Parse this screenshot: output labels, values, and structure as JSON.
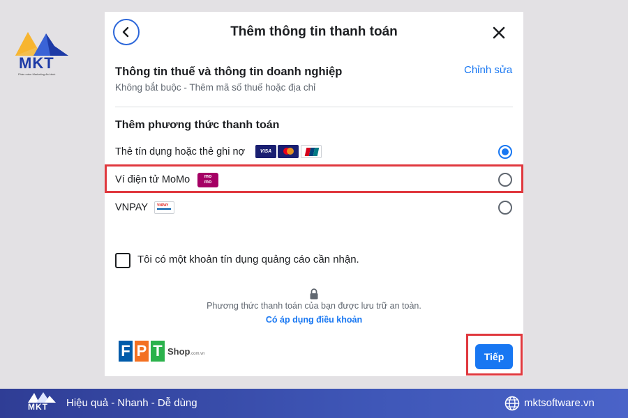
{
  "brand": {
    "logo_text": "MKT",
    "logo_tagline": "Phần mềm Marketing đa kênh",
    "colors": {
      "blue": "#1d3aa6",
      "orange": "#f5a623",
      "accent": "#1877f2",
      "highlight": "#e0383e"
    }
  },
  "dialog": {
    "title": "Thêm thông tin thanh toán",
    "back_icon": "chevron-left-icon",
    "close_icon": "close-icon",
    "tax": {
      "title": "Thông tin thuế và thông tin doanh nghiệp",
      "subtitle": "Không bắt buộc - Thêm mã số thuế hoặc địa chỉ",
      "edit_label": "Chỉnh sửa"
    },
    "payment_heading": "Thêm phương thức thanh toán",
    "options": [
      {
        "label": "Thẻ tín dụng hoặc thẻ ghi nợ",
        "selected": true,
        "icons": [
          "VISA",
          "mastercard-icon",
          "unionpay-icon"
        ]
      },
      {
        "label": "Ví điện tử MoMo",
        "selected": false,
        "logo_text": "mo mo"
      },
      {
        "label": "VNPAY",
        "selected": false,
        "logo_text": "VNPAY"
      }
    ],
    "credit_checkbox_label": "Tôi có một khoản tín dụng quảng cáo cần nhận.",
    "secure_text": "Phương thức thanh toán của bạn được lưu trữ an toàn.",
    "terms_link": "Có áp dụng điều khoản",
    "next_button": "Tiếp"
  },
  "watermark": {
    "fpt_letters": [
      "F",
      "P",
      "T"
    ],
    "fpt_shop": "Shop",
    "fpt_domain": ".com.vn"
  },
  "footer": {
    "logo_text": "MKT",
    "slogan": "Hiệu quả - Nhanh - Dễ dùng",
    "website": "mktsoftware.vn",
    "globe_icon": "globe-icon"
  }
}
